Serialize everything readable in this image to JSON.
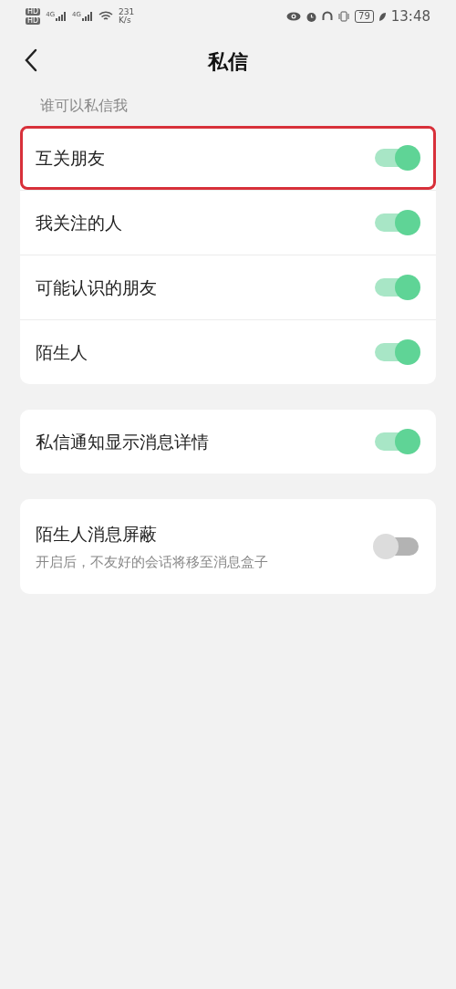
{
  "status_bar": {
    "sim_labels": [
      "HD",
      "HD"
    ],
    "network_labels": [
      "4G",
      "4G"
    ],
    "speed_value": "231",
    "speed_unit": "K/s",
    "battery": "79",
    "time": "13:48"
  },
  "header": {
    "title": "私信"
  },
  "section_label": "谁可以私信我",
  "groups": [
    {
      "items": [
        {
          "label": "互关朋友",
          "on": true,
          "highlighted": true
        },
        {
          "label": "我关注的人",
          "on": true,
          "highlighted": false
        },
        {
          "label": "可能认识的朋友",
          "on": true,
          "highlighted": false
        },
        {
          "label": "陌生人",
          "on": true,
          "highlighted": false
        }
      ]
    },
    {
      "items": [
        {
          "label": "私信通知显示消息详情",
          "on": true,
          "highlighted": false
        }
      ]
    },
    {
      "items": [
        {
          "label": "陌生人消息屏蔽",
          "on": false,
          "highlighted": false,
          "description": "开启后，不友好的会话将移至消息盒子"
        }
      ]
    }
  ]
}
